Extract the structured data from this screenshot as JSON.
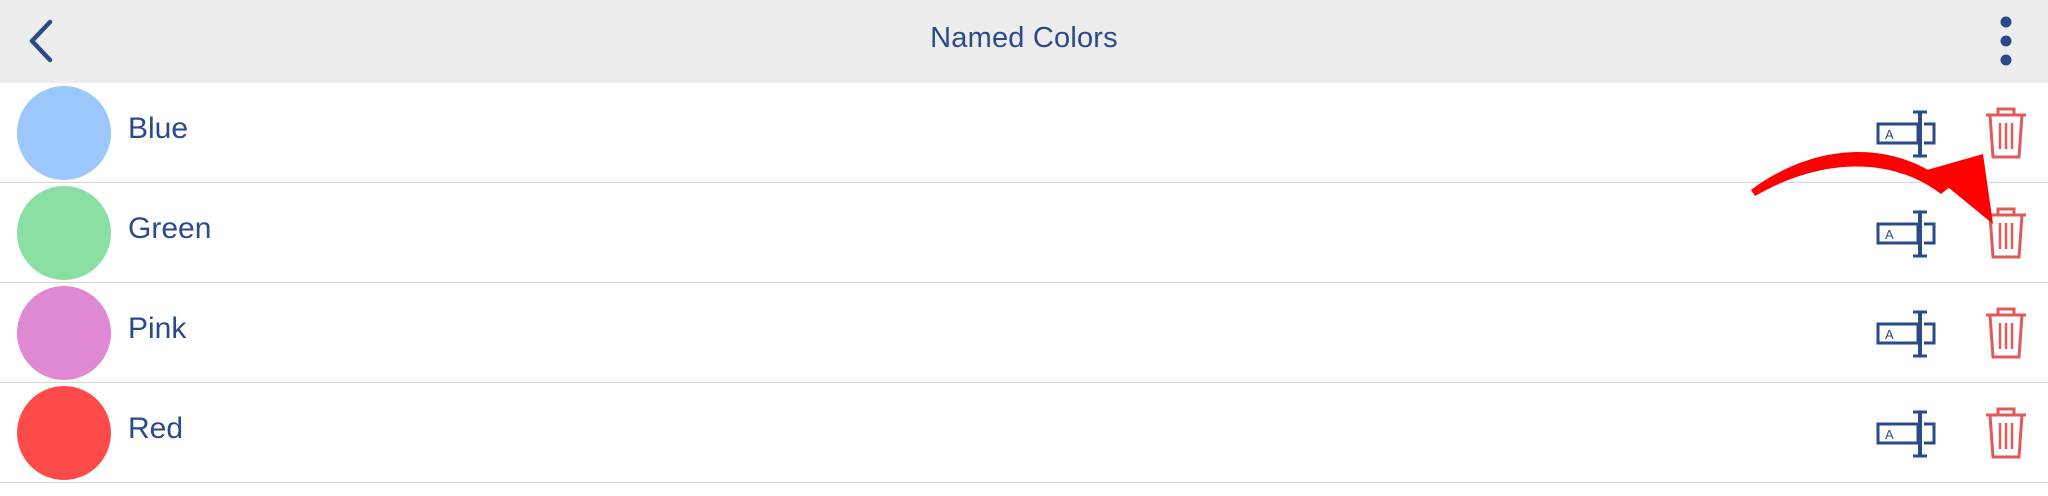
{
  "header": {
    "title": "Named Colors",
    "back_icon": "chevron-left-icon",
    "menu_icon": "vertical-ellipsis-icon"
  },
  "colors": [
    {
      "label": "Blue",
      "color": "#9cc7fc"
    },
    {
      "label": "Green",
      "color": "#8ae0a3"
    },
    {
      "label": "Pink",
      "color": "#df88d4"
    },
    {
      "label": "Red",
      "color": "#ff4a4a"
    }
  ],
  "row_actions": {
    "rename_icon": "rename-text-cursor-icon",
    "rename_glyph": "A",
    "delete_icon": "trash-icon"
  },
  "theme": {
    "accent": "#2a4a8a",
    "delete": "#e05a5a",
    "annotation_arrow": "#ff0000"
  }
}
